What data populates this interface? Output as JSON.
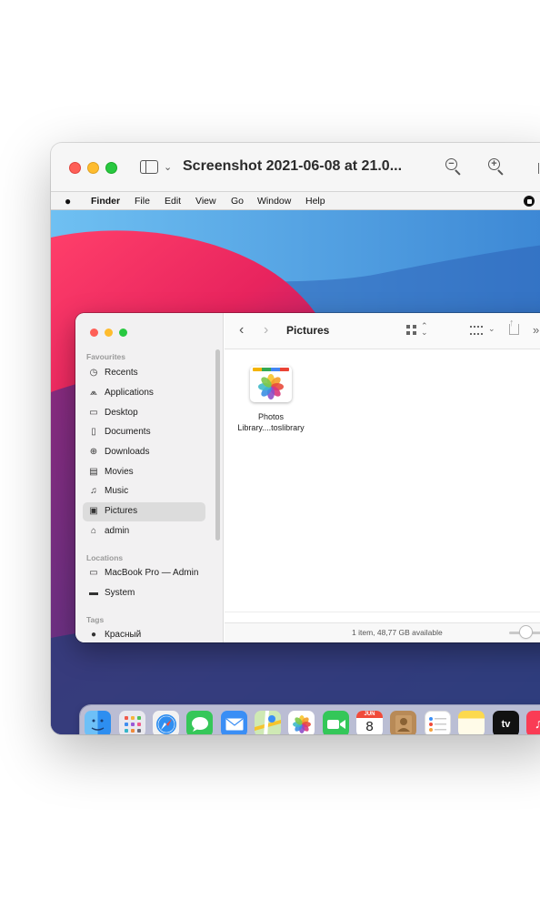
{
  "preview_window": {
    "title": "Screenshot 2021-06-08 at 21.0..."
  },
  "menubar": {
    "apple": "",
    "items": [
      "Finder",
      "File",
      "Edit",
      "View",
      "Go",
      "Window",
      "Help"
    ]
  },
  "finder": {
    "title": "Pictures",
    "sidebar": {
      "favourites_label": "Favourites",
      "favourites": [
        {
          "label": "Recents",
          "icon": "clock-icon"
        },
        {
          "label": "Applications",
          "icon": "applications-icon"
        },
        {
          "label": "Desktop",
          "icon": "desktop-icon"
        },
        {
          "label": "Documents",
          "icon": "document-icon"
        },
        {
          "label": "Downloads",
          "icon": "download-icon"
        },
        {
          "label": "Movies",
          "icon": "film-icon"
        },
        {
          "label": "Music",
          "icon": "music-note-icon"
        },
        {
          "label": "Pictures",
          "icon": "photo-icon",
          "selected": true
        },
        {
          "label": "admin",
          "icon": "home-icon"
        }
      ],
      "locations_label": "Locations",
      "locations": [
        {
          "label": "MacBook Pro — Admin",
          "icon": "laptop-icon"
        },
        {
          "label": "System",
          "icon": "disk-icon"
        }
      ],
      "tags_label": "Tags",
      "tags": [
        {
          "label": "Красный",
          "color": "#000000"
        }
      ]
    },
    "files": [
      {
        "name_line1": "Photos",
        "name_line2": "Library....toslibrary",
        "icon": "photos-library-icon"
      }
    ],
    "status": "1 item, 48,77 GB available"
  },
  "dock": {
    "apps": [
      {
        "name": "finder-icon",
        "color": "#3d9bf0",
        "running": true
      },
      {
        "name": "launchpad-icon",
        "color": "#e9e9ef"
      },
      {
        "name": "safari-icon",
        "color": "#2f8ef0"
      },
      {
        "name": "messages-icon",
        "color": "#35c759"
      },
      {
        "name": "mail-icon",
        "color": "#3a8ef5"
      },
      {
        "name": "maps-icon",
        "color": "#7fcf6a"
      },
      {
        "name": "photos-icon",
        "color": "#ffffff"
      },
      {
        "name": "facetime-icon",
        "color": "#34c759"
      },
      {
        "name": "calendar-icon",
        "color": "#ffffff",
        "month": "JUN",
        "day": "8"
      },
      {
        "name": "contacts-icon",
        "color": "#b88a57"
      },
      {
        "name": "reminders-icon",
        "color": "#ffffff"
      },
      {
        "name": "notes-icon",
        "color": "#fcd94e"
      },
      {
        "name": "apple-tv-icon",
        "color": "#111111",
        "label": "tv"
      },
      {
        "name": "music-app-icon",
        "color": "#fa3c55"
      }
    ]
  }
}
